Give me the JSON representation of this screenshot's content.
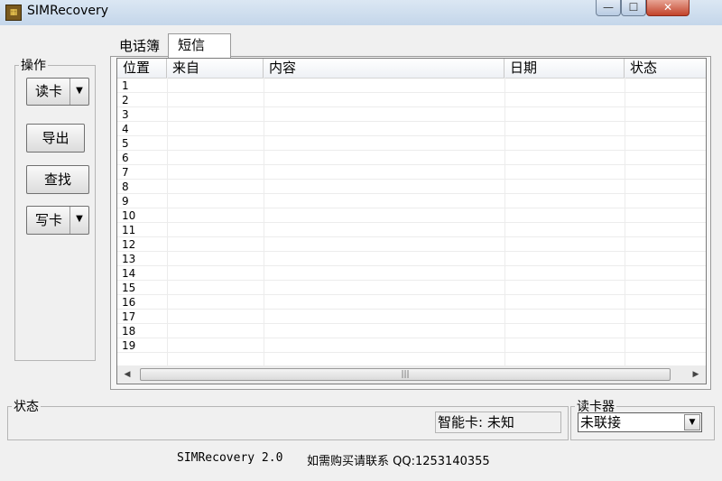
{
  "window": {
    "title": "SIMRecovery",
    "icon_name": "sim-card-icon",
    "controls": {
      "minimize": "—",
      "maximize": "☐",
      "close": "✕"
    }
  },
  "operations": {
    "legend": "操作",
    "read_card": "读卡",
    "export": "导出",
    "find": "查找",
    "write_card": "写卡"
  },
  "tabs": [
    "电话簿",
    "短信"
  ],
  "active_tab": "短信",
  "table": {
    "columns": [
      "位置",
      "来自",
      "内容",
      "日期",
      "状态"
    ],
    "rows": [
      "1",
      "2",
      "3",
      "4",
      "5",
      "6",
      "7",
      "8",
      "9",
      "10",
      "11",
      "12",
      "13",
      "14",
      "15",
      "16",
      "17",
      "18",
      "19"
    ]
  },
  "status": {
    "legend": "状态",
    "smart_card": "智能卡: 未知"
  },
  "reader": {
    "legend": "读卡器",
    "selected": "未联接"
  },
  "footer": {
    "version": "SIMRecovery 2.0",
    "contact": "如需购买请联系 QQ:1253140355"
  }
}
